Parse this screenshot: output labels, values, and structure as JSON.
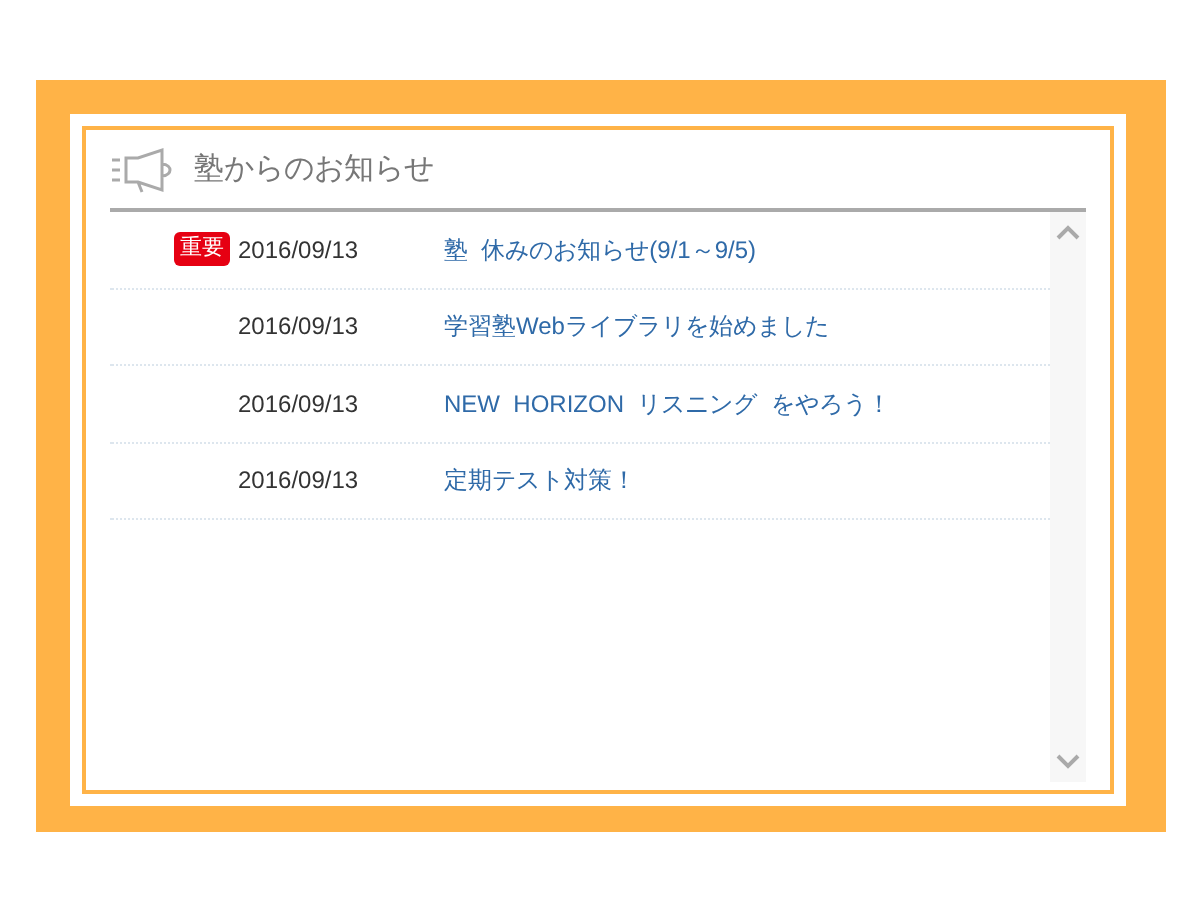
{
  "title": "塾からのお知らせ",
  "notices": [
    {
      "badge": "重要",
      "date": "2016/09/13",
      "title": "塾  休みのお知らせ(9/1～9/5)"
    },
    {
      "date": "2016/09/13",
      "title": "学習塾Webライブラリを始めました"
    },
    {
      "date": "2016/09/13",
      "title": "NEW  HORIZON  リスニング  をやろう！"
    },
    {
      "date": "2016/09/13",
      "title": "定期テスト対策！"
    }
  ]
}
